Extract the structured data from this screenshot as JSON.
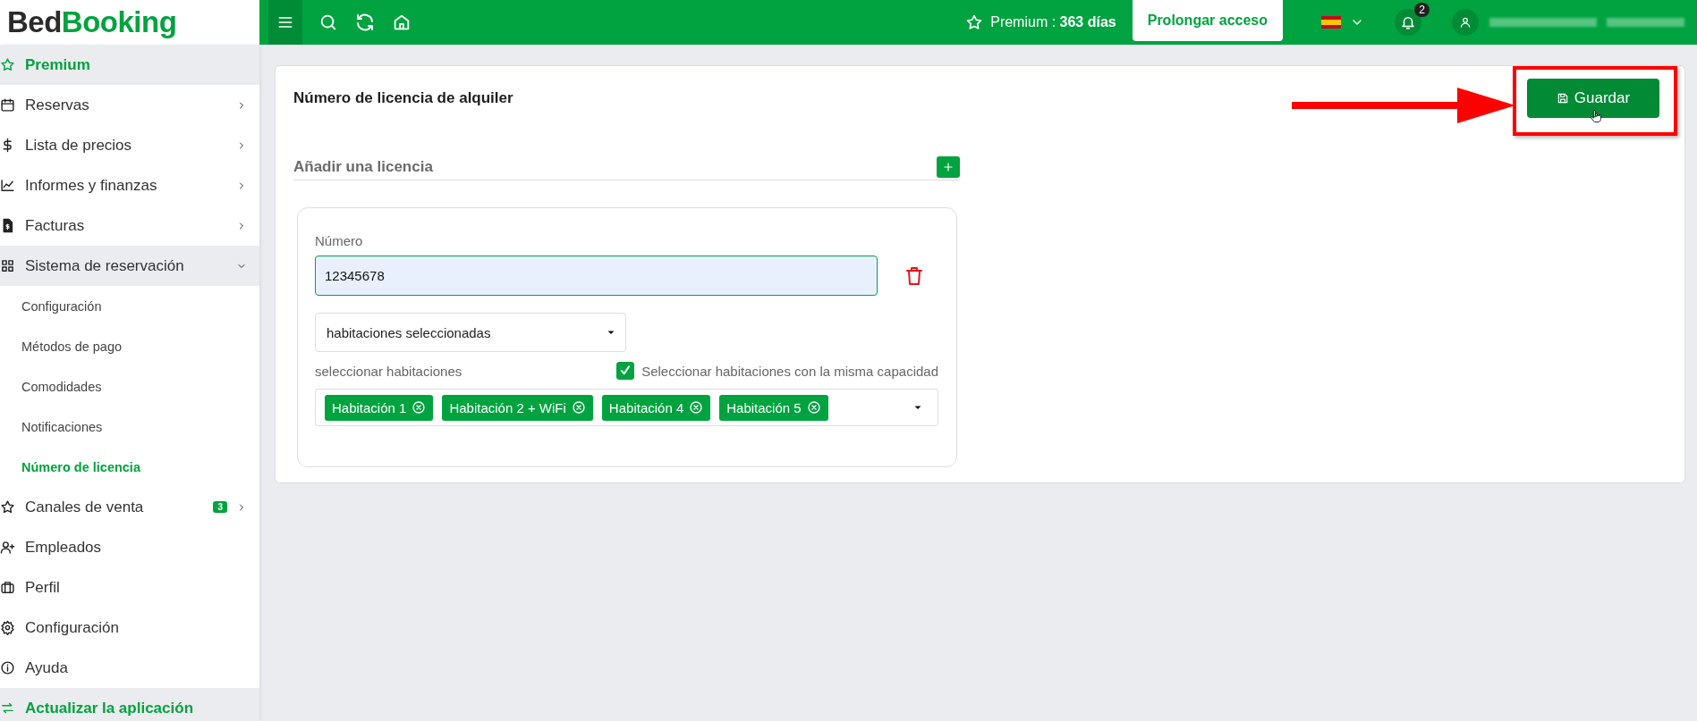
{
  "logo": {
    "part_1": "Bed",
    "part_2": "Booking"
  },
  "topbar": {
    "premium_label": "Premium :",
    "premium_value": "363 días",
    "extend_button": "Prolongar acceso",
    "notifications_count": "2"
  },
  "sidebar": {
    "items": [
      {
        "label": "Premium",
        "kind": "promo",
        "selected": false
      },
      {
        "label": "Reservas",
        "kind": "item",
        "selected": false,
        "expanded": false
      },
      {
        "label": "Lista de precios",
        "kind": "item",
        "selected": false,
        "expanded": false
      },
      {
        "label": "Informes y finanzas",
        "kind": "item",
        "selected": false,
        "expanded": false
      },
      {
        "label": "Facturas",
        "kind": "item",
        "selected": false,
        "expanded": false
      },
      {
        "label": "Sistema de reservación",
        "kind": "item",
        "selected": false,
        "expanded": true,
        "children": [
          {
            "label": "Configuración",
            "selected": false
          },
          {
            "label": "Métodos de pago",
            "selected": false
          },
          {
            "label": "Comodidades",
            "selected": false
          },
          {
            "label": "Notificaciones",
            "selected": false
          },
          {
            "label": "Número de licencia",
            "selected": true
          }
        ]
      },
      {
        "label": "Canales de venta",
        "kind": "item",
        "selected": false,
        "expanded": false,
        "badge": "3"
      },
      {
        "label": "Empleados",
        "kind": "plain",
        "selected": false
      },
      {
        "label": "Perfil",
        "kind": "plain",
        "selected": false
      },
      {
        "label": "Configuración",
        "kind": "plain",
        "selected": false
      },
      {
        "label": "Ayuda",
        "kind": "plain",
        "selected": false
      },
      {
        "label": "Actualizar la aplicación",
        "kind": "promo",
        "selected": false
      }
    ]
  },
  "main": {
    "title": "Número de licencia de alquiler",
    "save_button": "Guardar",
    "add_license": "Añadir una licencia",
    "licenses": [
      {
        "number_label": "Número",
        "number_value": "12345678",
        "scope": "habitaciones seleccionadas",
        "rooms_label": "seleccionar habitaciones",
        "same_capacity": {
          "label": "Seleccionar habitaciones con la misma capacidad",
          "checked": true
        },
        "rooms": [
          "Habitación 1",
          "Habitación 2 + WiFi",
          "Habitación 4",
          "Habitación 5"
        ]
      }
    ]
  }
}
